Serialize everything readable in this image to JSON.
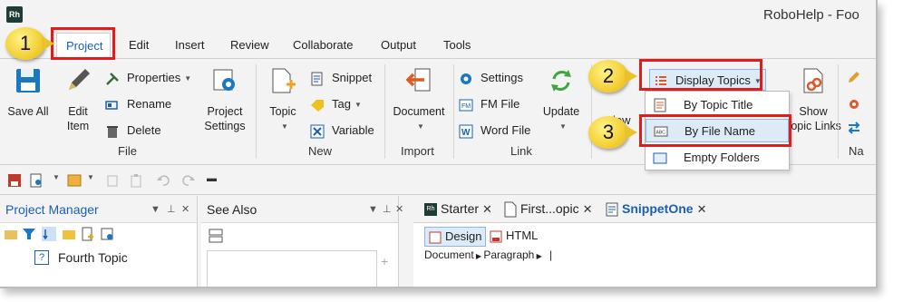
{
  "window": {
    "app_icon": "Rh",
    "title": "RoboHelp - Foo"
  },
  "ribbon_tabs": [
    "Project",
    "Edit",
    "Insert",
    "Review",
    "Collaborate",
    "Output",
    "Tools"
  ],
  "ribbon": {
    "file_group": {
      "label": "File",
      "save_all": "Save All",
      "edit_item": "Edit Item",
      "properties": "Properties",
      "rename": "Rename",
      "delete": "Delete",
      "project_settings": "Project Settings"
    },
    "new_group": {
      "label": "New",
      "topic": "Topic",
      "snippet": "Snippet",
      "tag": "Tag",
      "variable": "Variable"
    },
    "import_group": {
      "label": "Import",
      "document": "Document"
    },
    "link_group": {
      "label": "Link",
      "settings": "Settings",
      "fm_file": "FM File",
      "word_file": "Word File",
      "update": "Update"
    },
    "view_partial": "iew",
    "display_topics": "Display Topics",
    "show_topic_links": "Show Topic Links",
    "nav_partial": "Na"
  },
  "dropdown": {
    "items": [
      "By Topic Title",
      "By File Name",
      "Empty Folders"
    ],
    "highlighted": "By File Name"
  },
  "callouts": [
    "1",
    "2",
    "3"
  ],
  "panels": {
    "project_manager": {
      "title": "Project Manager",
      "tree": [
        "Fourth Topic"
      ]
    },
    "see_also": {
      "title": "See Also"
    }
  },
  "doc_tabs": [
    {
      "label": "Starter",
      "icon": "rh-icon"
    },
    {
      "label": "First...opic",
      "icon": "page-icon"
    },
    {
      "label": "SnippetOne",
      "icon": "snippet-icon"
    }
  ],
  "editor": {
    "design": "Design",
    "html": "HTML",
    "breadcrumb_document": "Document",
    "breadcrumb_paragraph": "Paragraph",
    "breadcrumb_end": "|"
  },
  "colors": {
    "accent": "#1a5fb4",
    "highlight_box": "#e21b1b",
    "callout": "#f4d23a",
    "hover": "#dcebf7"
  }
}
